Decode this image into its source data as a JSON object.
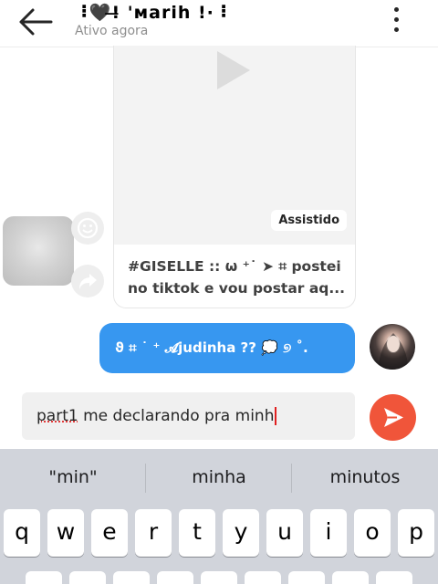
{
  "header": {
    "title": "⠸🖤!̶ 'ᴍarih !·⠸",
    "subtitle": "Ativo agora"
  },
  "shared_post": {
    "badge": "Assistido",
    "caption_line1": "#GISELLE :: ω ⁺˙ ➤ ⌗ postei",
    "caption_line2": "no tiktok e vou postar aq..."
  },
  "my_message": {
    "text": "ϑ ⌗ ˙ ⁺ 𝓐judinha ?? 💭 ୭ ˚."
  },
  "composer": {
    "text_misspelled": "part1",
    "text_rest": " me declarando pra minh"
  },
  "keyboard": {
    "suggestions": [
      "\"min\"",
      "minha",
      "minutos"
    ],
    "row1": [
      "q",
      "w",
      "e",
      "r",
      "t",
      "y",
      "u",
      "i",
      "o",
      "p"
    ]
  },
  "colors": {
    "message_blue": "#3797f0",
    "send_red": "#f0553a",
    "keyboard_bg": "#d1d4db"
  },
  "icons": {
    "back": "arrow-left-icon",
    "menu": "more-vertical-icon",
    "play": "play-icon",
    "react": "emoji-icon",
    "share": "share-icon",
    "send": "send-icon"
  }
}
